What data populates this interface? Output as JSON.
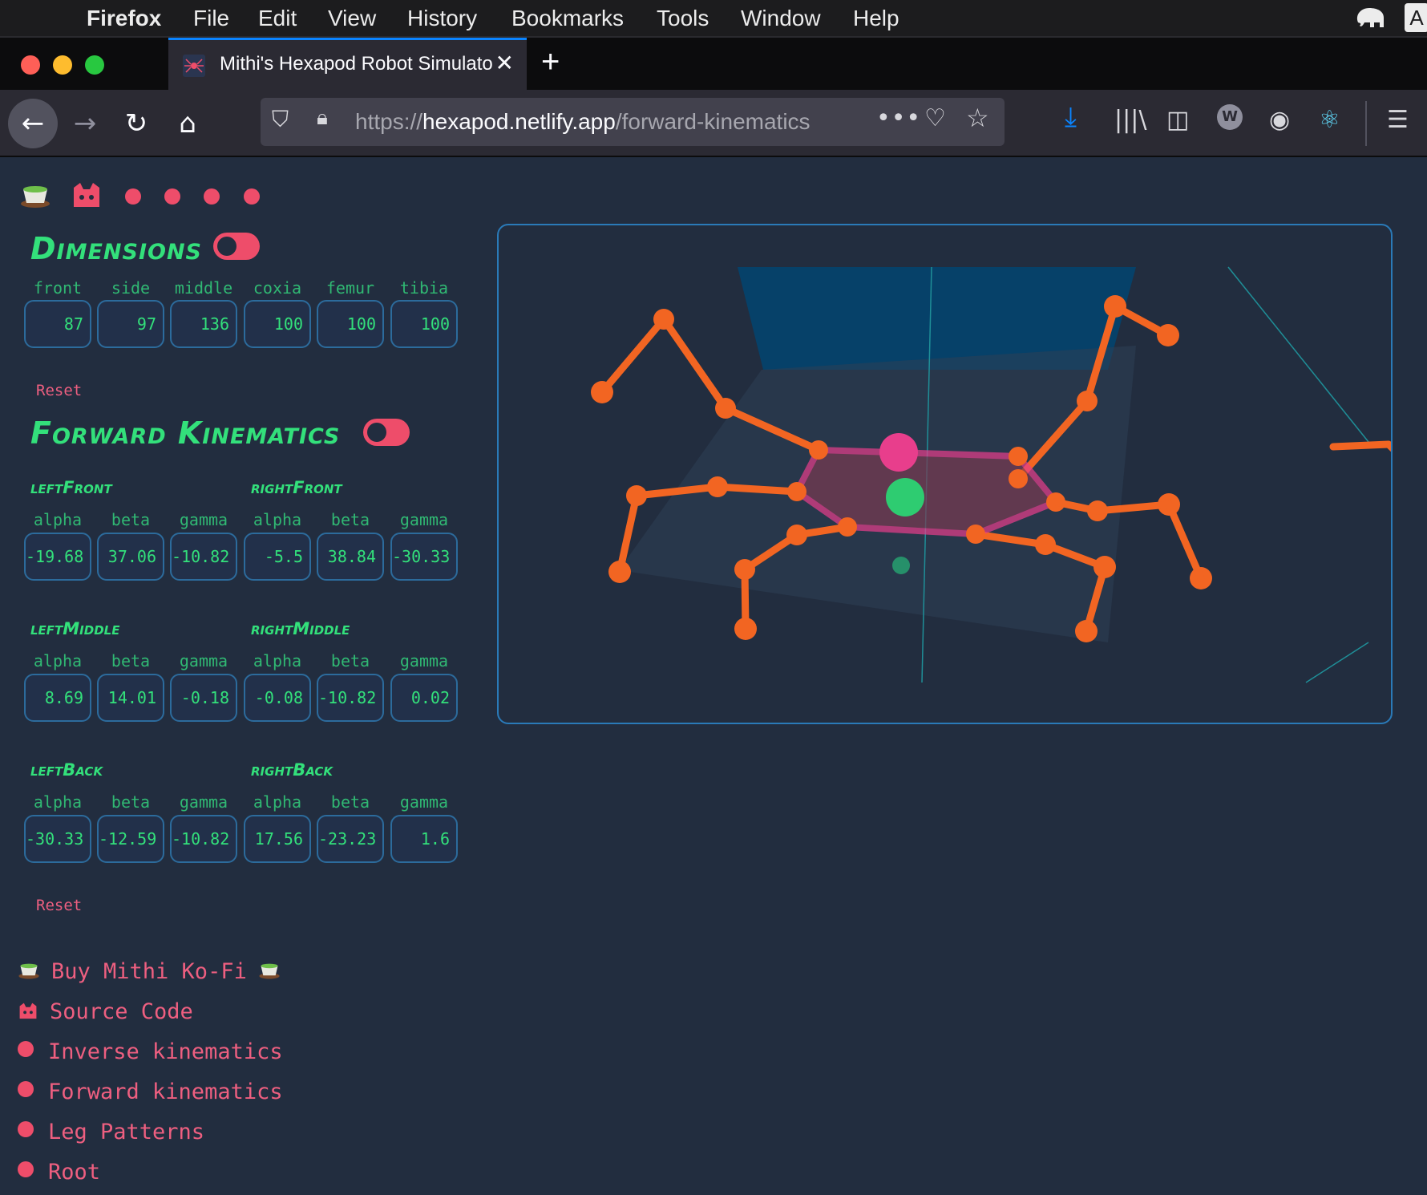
{
  "menubar": {
    "app_name": "Firefox",
    "items": [
      "File",
      "Edit",
      "View",
      "History",
      "Bookmarks",
      "Tools",
      "Window",
      "Help"
    ],
    "right_letter": "A"
  },
  "tab": {
    "title": "Mithi's Hexapod Robot Simulator",
    "close_icon": "close-icon"
  },
  "urlbar": {
    "scheme": "https://",
    "host": "hexapod.netlify.app",
    "path": "/forward-kinematics"
  },
  "colors": {
    "accent_pink": "#ee4d6a",
    "accent_green": "#33e07b",
    "background": "#222d3f",
    "leg_orange": "#f26522",
    "body_pink": "#e83e8c"
  },
  "dimensions": {
    "title": "Dimensions",
    "fields": [
      {
        "label": "front",
        "value": "87"
      },
      {
        "label": "side",
        "value": "97"
      },
      {
        "label": "middle",
        "value": "136"
      },
      {
        "label": "coxia",
        "value": "100"
      },
      {
        "label": "femur",
        "value": "100"
      },
      {
        "label": "tibia",
        "value": "100"
      }
    ],
    "reset": "Reset"
  },
  "forward_kinematics": {
    "title": "Forward Kinematics",
    "legs": [
      {
        "name": "leftFront",
        "alpha": "-19.68",
        "beta": "37.06",
        "gamma": "-10.82"
      },
      {
        "name": "rightFront",
        "alpha": "-5.5",
        "beta": "38.84",
        "gamma": "-30.33"
      },
      {
        "name": "leftMiddle",
        "alpha": "8.69",
        "beta": "14.01",
        "gamma": "-0.18"
      },
      {
        "name": "rightMiddle",
        "alpha": "-0.08",
        "beta": "-10.82",
        "gamma": "0.02"
      },
      {
        "name": "leftBack",
        "alpha": "-30.33",
        "beta": "-12.59",
        "gamma": "-10.82"
      },
      {
        "name": "rightBack",
        "alpha": "17.56",
        "beta": "-23.23",
        "gamma": "1.6"
      }
    ],
    "angle_labels": [
      "alpha",
      "beta",
      "gamma"
    ],
    "reset": "Reset"
  },
  "links": [
    {
      "label": "Buy Mithi Ko-Fi",
      "icon": "tea-cup-icon"
    },
    {
      "label": "Source Code",
      "icon": "github-cat-icon"
    },
    {
      "label": "Inverse kinematics",
      "icon": "dot-icon"
    },
    {
      "label": "Forward kinematics",
      "icon": "dot-icon"
    },
    {
      "label": "Leg Patterns",
      "icon": "dot-icon"
    },
    {
      "label": "Root",
      "icon": "dot-icon"
    }
  ]
}
